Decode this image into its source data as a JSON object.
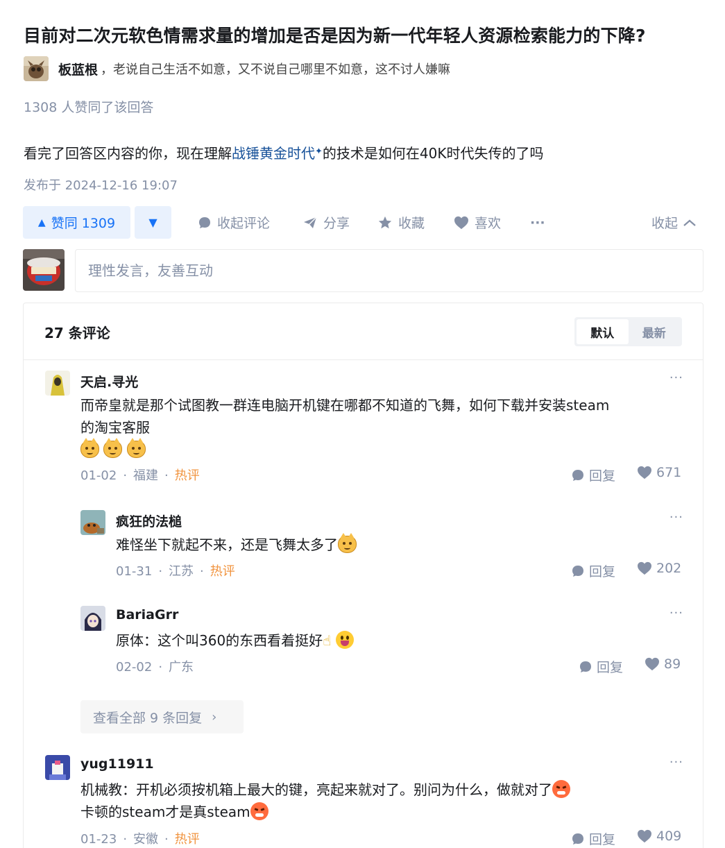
{
  "question": {
    "title": "目前对二次元软色情需求量的增加是否是因为新一代年轻人资源检索能力的下降?"
  },
  "author": {
    "name": "板蓝根",
    "bio": "，老说自己生活不如意，又不说自己哪里不如意，这不讨人嫌嘛"
  },
  "answer": {
    "vote_summary": "1308 人赞同了该回答",
    "text_before": "看完了回答区内容的你，现在理解",
    "link_text": "战锤黄金时代",
    "link_mark": "✦",
    "text_after": "的技术是如何在40K时代失传的了吗",
    "publish_time": "发布于 2024-12-16 19:07"
  },
  "actions": {
    "vote_up": "赞同 1309",
    "vote_down_icon": "▼",
    "collapse_comments": "收起评论",
    "share": "分享",
    "favorite": "收藏",
    "like": "喜欢",
    "more": "···",
    "collapse": "收起"
  },
  "comment_input": {
    "placeholder": "理性发言，友善互动"
  },
  "comments": {
    "count_label": "27 条评论",
    "sort": {
      "default": "默认",
      "latest": "最新"
    },
    "view_all": "查看全部 9 条回复",
    "more": "···",
    "reply_label": "回复",
    "items": [
      {
        "name": "天启.寻光",
        "text_line1": "而帝皇就是那个试图教一群连电脑开机键在哪都不知道的飞舞，如何下载并安装steam",
        "text_line2": "的淘宝客服",
        "emojis": [
          "cat-emoji",
          "cat-emoji",
          "cat-emoji"
        ],
        "date": "01-02",
        "location": "福建",
        "tag": "热评",
        "likes": "671"
      },
      {
        "name": "疯狂的法槌",
        "text": "难怪坐下就起不来，还是飞舞太多了",
        "emojis": [
          "cat-emoji"
        ],
        "date": "01-31",
        "location": "江苏",
        "tag": "热评",
        "likes": "202"
      },
      {
        "name": "BariaGrr",
        "text": "原体：这个叫360的东西看着挺好",
        "emojis": [
          "pointing-up-emoji",
          "tongue-emoji"
        ],
        "date": "02-02",
        "location": "广东",
        "likes": "89"
      },
      {
        "name": "yug11911",
        "text_line1": "机械教：开机必须按机箱上最大的键，亮起来就对了。别问为什么，做就对了",
        "text_line2": "卡顿的steam才是真steam",
        "emojis": [
          "angry-emoji",
          "angry-emoji"
        ],
        "date": "01-23",
        "location": "安徽",
        "tag": "热评",
        "likes": "409"
      }
    ]
  },
  "colors": {
    "primary": "#1772f6",
    "link": "#175199",
    "muted": "#8590a6",
    "hot": "#f1943f",
    "vote_bg": "#e9f1fd"
  }
}
